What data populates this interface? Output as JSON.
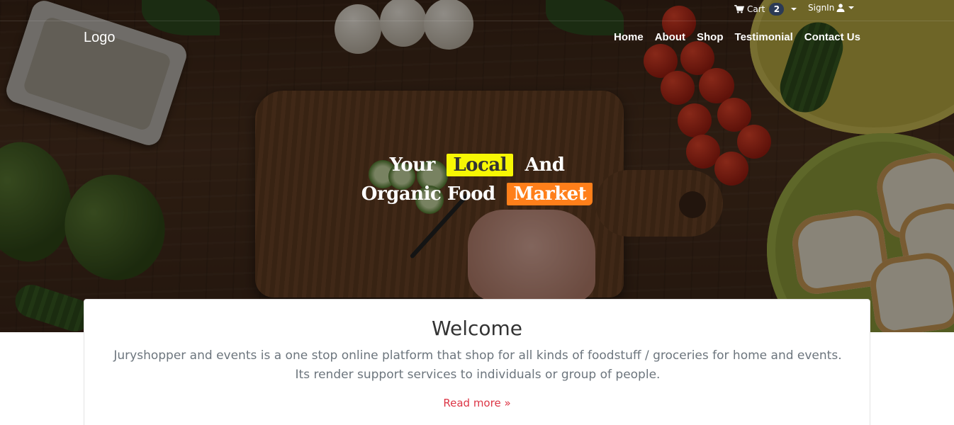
{
  "header": {
    "logo_text": "Logo",
    "cart": {
      "label": "Cart",
      "count": "2"
    },
    "signin": {
      "label": "SignIn"
    },
    "nav": [
      "Home",
      "About",
      "Shop",
      "Testimonial",
      "Contact Us"
    ]
  },
  "hero": {
    "line1": {
      "pre": "Your",
      "highlight": "Local",
      "post": "And"
    },
    "line2": {
      "pre": "Organic Food",
      "highlight": "Market"
    }
  },
  "welcome": {
    "title": "Welcome",
    "text": "Juryshopper and events is a one stop online platform that shop for all kinds of foodstuff / groceries for home and events. Its render support services to individuals or group of people.",
    "read_more": "Read more »"
  },
  "colors": {
    "highlight_yellow": "#f7f704",
    "highlight_orange": "#ff7f1a",
    "badge": "#2b3a55",
    "link_red": "#dc3545"
  },
  "icons": [
    "shopping-cart-icon",
    "chevron-down-icon",
    "user-icon"
  ]
}
